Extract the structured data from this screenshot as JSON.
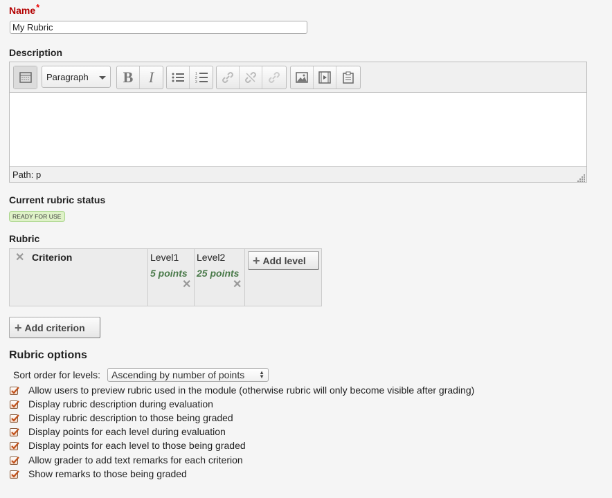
{
  "name_field": {
    "label": "Name",
    "required_marker": "*",
    "value": "My Rubric"
  },
  "description": {
    "label": "Description",
    "toolbar": {
      "format_select": "Paragraph",
      "buttons": [
        "toggle-toolbar-icon",
        "bold-icon",
        "italic-icon",
        "bullet-list-icon",
        "numbered-list-icon",
        "link-icon",
        "unlink-icon",
        "anchor-icon",
        "image-icon",
        "media-icon",
        "paste-text-icon"
      ]
    },
    "path_text": "Path: p"
  },
  "status": {
    "label": "Current rubric status",
    "badge": "READY FOR USE",
    "badge_color": "#dff2c8"
  },
  "rubric": {
    "label": "Rubric",
    "criterion_label": "Criterion",
    "levels": [
      {
        "title": "Level1",
        "points": "5 points"
      },
      {
        "title": "Level2",
        "points": "25 points"
      }
    ],
    "add_level_label": "Add level",
    "add_criterion_label": "Add criterion",
    "points_color": "#4a7a4a"
  },
  "options": {
    "title": "Rubric options",
    "sort_label": "Sort order for levels:",
    "sort_value": "Ascending by number of points",
    "checkboxes": [
      {
        "label": "Allow users to preview rubric used in the module (otherwise rubric will only become visible after grading)",
        "checked": true
      },
      {
        "label": "Display rubric description during evaluation",
        "checked": true
      },
      {
        "label": "Display rubric description to those being graded",
        "checked": true
      },
      {
        "label": "Display points for each level during evaluation",
        "checked": true
      },
      {
        "label": "Display points for each level to those being graded",
        "checked": true
      },
      {
        "label": "Allow grader to add text remarks for each criterion",
        "checked": true
      },
      {
        "label": "Show remarks to those being graded",
        "checked": true
      }
    ]
  }
}
